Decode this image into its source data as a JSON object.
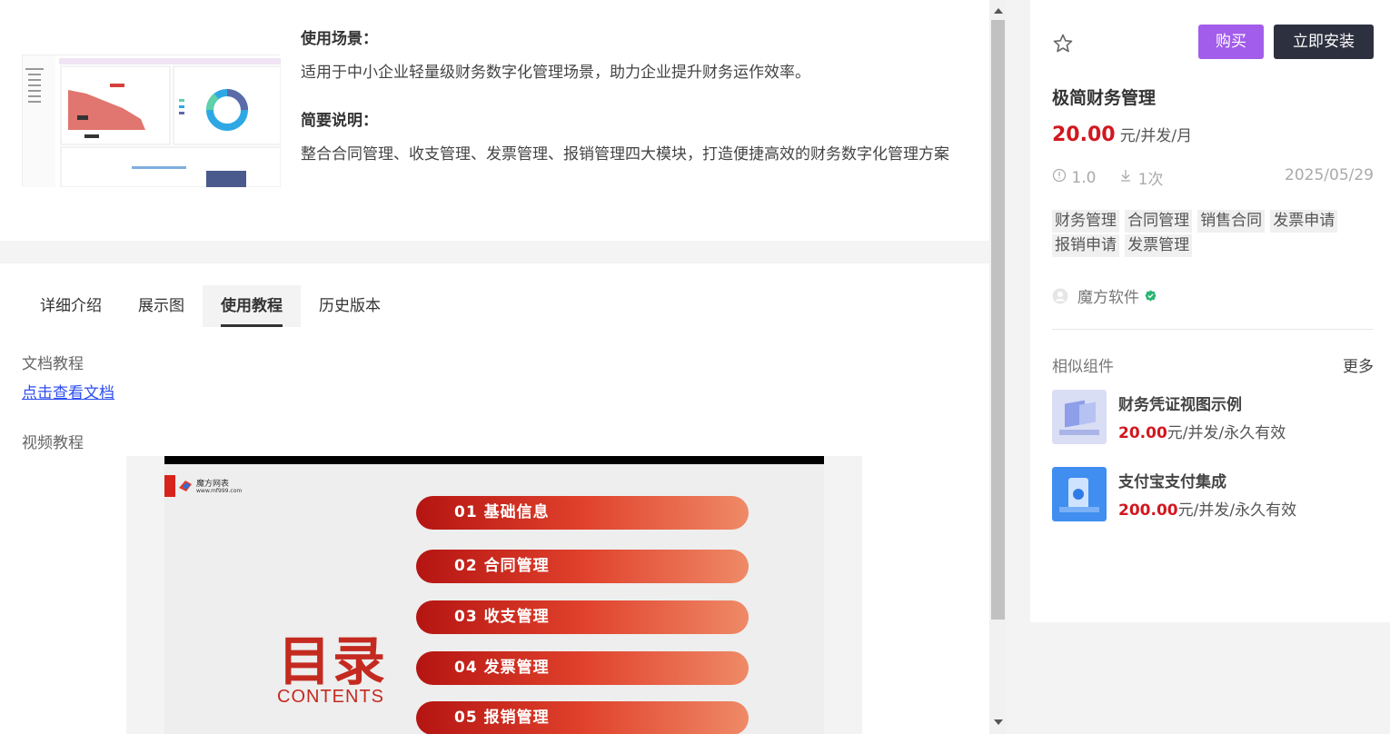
{
  "overview": {
    "scene_heading": "使用场景：",
    "scene_text": "适用于中小企业轻量级财务数字化管理场景，助力企业提升财务运作效率。",
    "summary_heading": "简要说明：",
    "summary_text": "整合合同管理、收支管理、发票管理、报销管理四大模块，打造便捷高效的财务数字化管理方案"
  },
  "tabs": [
    {
      "label": "详细介绍",
      "active": false
    },
    {
      "label": "展示图",
      "active": false
    },
    {
      "label": "使用教程",
      "active": true
    },
    {
      "label": "历史版本",
      "active": false
    }
  ],
  "tutorial": {
    "doc_label": "文档教程",
    "doc_link": "点击查看文档",
    "video_label": "视频教程"
  },
  "video_slide": {
    "logo_text": "魔方网表",
    "logo_url": "www.mf999.com",
    "title": "目录",
    "subtitle": "CONTENTS",
    "items": [
      "01  基础信息",
      "02  合同管理",
      "03  收支管理",
      "04  发票管理",
      "05  报销管理"
    ]
  },
  "product": {
    "buy_label": "购买",
    "install_label": "立即安装",
    "title": "极简财务管理",
    "price": "20.00",
    "unit": "元/并发/月",
    "version": "1.0",
    "downloads": "1次",
    "date": "2025/05/29",
    "tags": [
      "财务管理",
      "合同管理",
      "销售合同",
      "发票申请",
      "报销申请",
      "发票管理"
    ],
    "vendor": "魔方软件"
  },
  "similar": {
    "heading": "相似组件",
    "more": "更多",
    "items": [
      {
        "title": "财务凭证视图示例",
        "price": "20.00",
        "unit": "元/并发/永久有效"
      },
      {
        "title": "支付宝支付集成",
        "price": "200.00",
        "unit": "元/并发/永久有效"
      }
    ]
  },
  "colors": {
    "accent_purple": "#a25dea",
    "dark_button": "#2d303f",
    "price_red": "#d2171f",
    "link_blue": "#2d4df0"
  }
}
